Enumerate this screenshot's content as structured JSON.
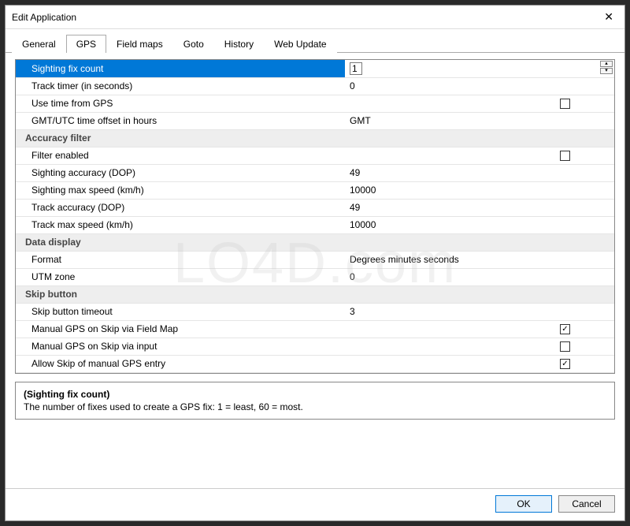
{
  "window": {
    "title": "Edit Application"
  },
  "tabs": [
    "General",
    "GPS",
    "Field maps",
    "Goto",
    "History",
    "Web Update"
  ],
  "active_tab": 1,
  "rows": [
    {
      "type": "value",
      "label": "Sighting fix count",
      "value": "1",
      "selected": true,
      "spinner": true
    },
    {
      "type": "value",
      "label": "Track timer (in seconds)",
      "value": "0"
    },
    {
      "type": "check",
      "label": "Use time from GPS",
      "checked": false
    },
    {
      "type": "value",
      "label": "GMT/UTC time offset in hours",
      "value": "GMT"
    },
    {
      "type": "header",
      "label": "Accuracy filter"
    },
    {
      "type": "check",
      "label": "Filter enabled",
      "checked": false
    },
    {
      "type": "value",
      "label": "Sighting accuracy (DOP)",
      "value": "49"
    },
    {
      "type": "value",
      "label": "Sighting max speed (km/h)",
      "value": "10000"
    },
    {
      "type": "value",
      "label": "Track accuracy (DOP)",
      "value": "49"
    },
    {
      "type": "value",
      "label": "Track max speed (km/h)",
      "value": "10000"
    },
    {
      "type": "header",
      "label": "Data display"
    },
    {
      "type": "value",
      "label": "Format",
      "value": "Degrees minutes seconds"
    },
    {
      "type": "value",
      "label": "UTM zone",
      "value": "0"
    },
    {
      "type": "header",
      "label": "Skip button"
    },
    {
      "type": "value",
      "label": "Skip button timeout",
      "value": "3"
    },
    {
      "type": "check",
      "label": "Manual GPS on Skip via Field Map",
      "checked": true
    },
    {
      "type": "check",
      "label": "Manual GPS on Skip via input",
      "checked": false
    },
    {
      "type": "check",
      "label": "Allow Skip of manual GPS entry",
      "checked": true
    }
  ],
  "help": {
    "title": "(Sighting fix count)",
    "body": "The number of fixes used to create a GPS fix: 1 = least, 60 = most."
  },
  "buttons": {
    "ok": "OK",
    "cancel": "Cancel"
  },
  "watermark": "LO4D.com"
}
